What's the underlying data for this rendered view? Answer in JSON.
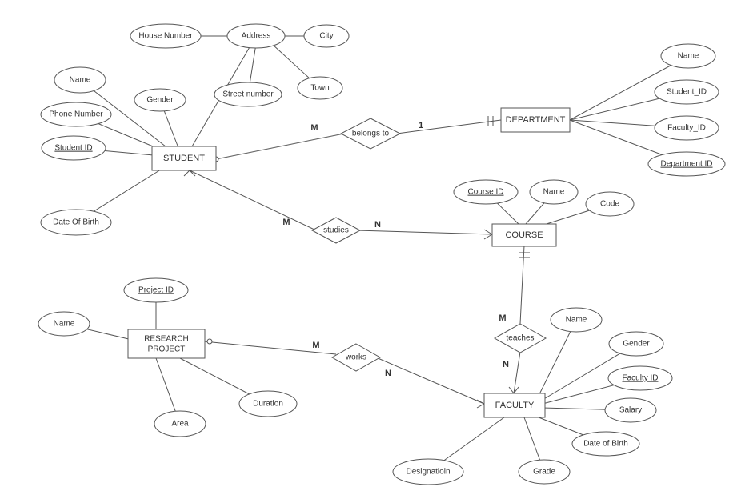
{
  "diagram": {
    "entities": {
      "student": {
        "label": "STUDENT"
      },
      "department": {
        "label": "DEPARTMENT"
      },
      "course": {
        "label": "COURSE"
      },
      "faculty": {
        "label": "FACULTY"
      },
      "research": {
        "label": "RESEARCH\nPROJECT"
      }
    },
    "relationships": {
      "belongs_to": {
        "label": "belongs to",
        "left_card": "M",
        "right_card": "1"
      },
      "studies": {
        "label": "studies",
        "left_card": "M",
        "right_card": "N"
      },
      "teaches": {
        "label": "teaches",
        "top_card": "M",
        "bottom_card": "N"
      },
      "works": {
        "label": "works",
        "left_card": "M",
        "right_card": "N"
      }
    },
    "attributes": {
      "student": {
        "name": {
          "label": "Name"
        },
        "phone": {
          "label": "Phone Number"
        },
        "student_id": {
          "label": "Student  ID",
          "key": true
        },
        "gender": {
          "label": "Gender"
        },
        "dob": {
          "label": "Date Of Birth"
        },
        "address": {
          "label": "Address"
        },
        "house_no": {
          "label": "House Number"
        },
        "street_no": {
          "label": "Street number"
        },
        "city": {
          "label": "City"
        },
        "town": {
          "label": "Town"
        }
      },
      "department": {
        "name": {
          "label": "Name"
        },
        "student_id": {
          "label": "Student_ID"
        },
        "faculty_id": {
          "label": "Faculty_ID"
        },
        "dept_id": {
          "label": "Department  ID",
          "key": true
        }
      },
      "course": {
        "course_id": {
          "label": "Course  ID",
          "key": true
        },
        "name": {
          "label": "Name"
        },
        "code": {
          "label": "Code"
        }
      },
      "faculty": {
        "name": {
          "label": "Name"
        },
        "gender": {
          "label": "Gender"
        },
        "faculty_id": {
          "label": "Faculty  ID",
          "key": true
        },
        "salary": {
          "label": "Salary"
        },
        "dob": {
          "label": "Date of Birth"
        },
        "grade": {
          "label": "Grade"
        },
        "designation": {
          "label": "Designatioin"
        }
      },
      "research": {
        "project_id": {
          "label": "Project  ID",
          "key": true
        },
        "name": {
          "label": "Name"
        },
        "area": {
          "label": "Area"
        },
        "duration": {
          "label": "Duration"
        }
      }
    }
  }
}
